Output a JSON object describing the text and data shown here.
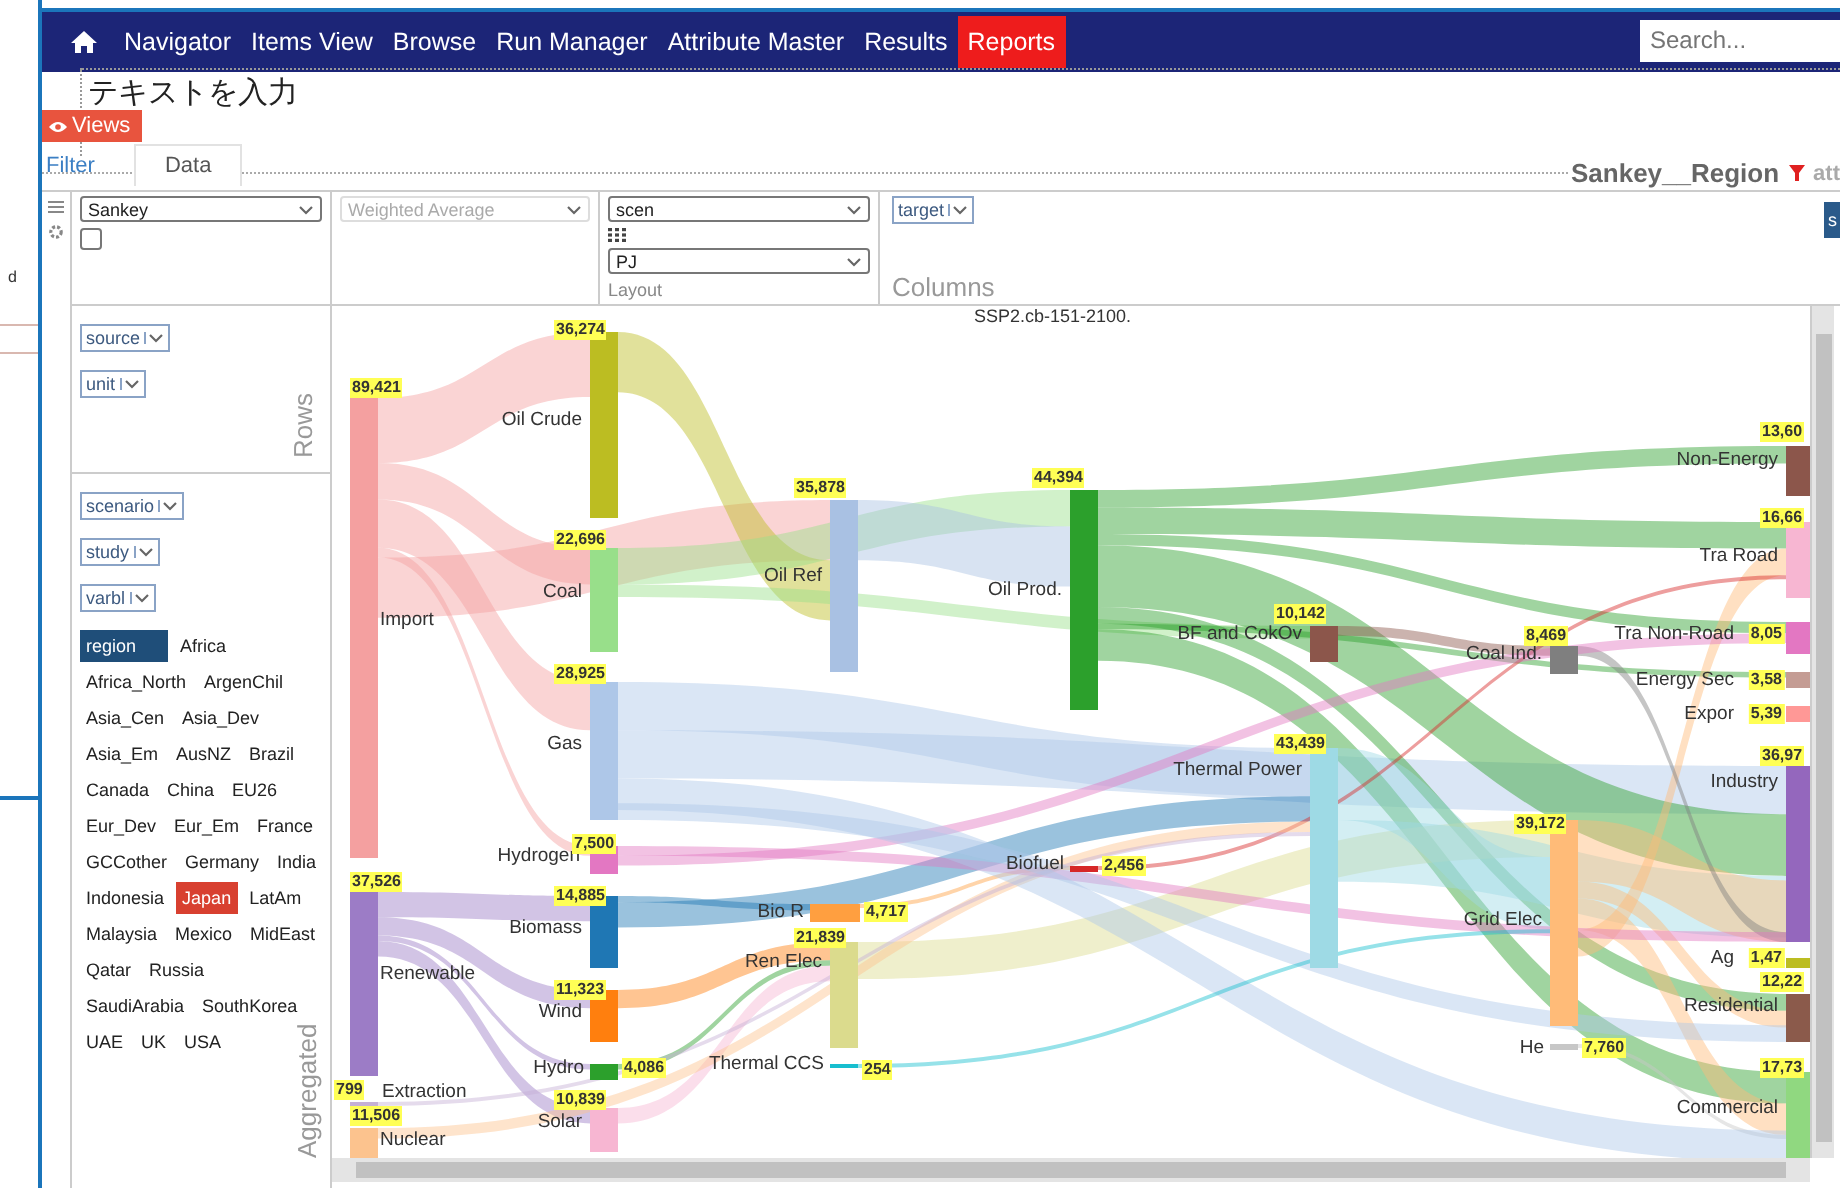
{
  "backdrop_text": "d",
  "nav": {
    "items": [
      {
        "label": "Navigator",
        "selected": false
      },
      {
        "label": "Items View",
        "selected": false
      },
      {
        "label": "Browse",
        "selected": false
      },
      {
        "label": "Run Manager",
        "selected": false
      },
      {
        "label": "Attribute Master",
        "selected": false
      },
      {
        "label": "Results",
        "selected": false
      },
      {
        "label": "Reports",
        "selected": true
      }
    ],
    "search": {
      "placeholder": "Search..."
    }
  },
  "textbox_text": "テキストを入力",
  "views_button": "Views",
  "tabs": [
    {
      "label": "Filter",
      "selected": false
    },
    {
      "label": "Data",
      "selected": true
    }
  ],
  "report_title": "Sankey__Region",
  "attribute_link": "att",
  "pivot": {
    "renderer": "Sankey",
    "checkbox_checked": false,
    "aggregator": "Weighted Average",
    "aggregator_disabled": true,
    "value_field": "scen",
    "unit_field": "PJ",
    "layout_label": "Layout",
    "column_fields": [
      "target"
    ],
    "columns_label": "Columns",
    "side_button": "s",
    "row_fields": [
      "source",
      "unit"
    ],
    "rows_label": "Rows",
    "unused_fields": [
      "scenario",
      "study",
      "varbl"
    ],
    "aggregated_label": "Aggregated",
    "filter": {
      "field": "region",
      "values": [
        {
          "label": "Africa",
          "selected": false
        },
        {
          "label": "Africa_North",
          "selected": false
        },
        {
          "label": "ArgenChil",
          "selected": false
        },
        {
          "label": "Asia_Cen",
          "selected": false
        },
        {
          "label": "Asia_Dev",
          "selected": false
        },
        {
          "label": "Asia_Em",
          "selected": false
        },
        {
          "label": "AusNZ",
          "selected": false
        },
        {
          "label": "Brazil",
          "selected": false
        },
        {
          "label": "Canada",
          "selected": false
        },
        {
          "label": "China",
          "selected": false
        },
        {
          "label": "EU26",
          "selected": false
        },
        {
          "label": "Eur_Dev",
          "selected": false
        },
        {
          "label": "Eur_Em",
          "selected": false
        },
        {
          "label": "France",
          "selected": false
        },
        {
          "label": "GCCother",
          "selected": false
        },
        {
          "label": "Germany",
          "selected": false
        },
        {
          "label": "India",
          "selected": false
        },
        {
          "label": "Indonesia",
          "selected": false
        },
        {
          "label": "Japan",
          "selected": true
        },
        {
          "label": "LatAm",
          "selected": false
        },
        {
          "label": "Malaysia",
          "selected": false
        },
        {
          "label": "Mexico",
          "selected": false
        },
        {
          "label": "MidEast",
          "selected": false
        },
        {
          "label": "Qatar",
          "selected": false
        },
        {
          "label": "Russia",
          "selected": false
        },
        {
          "label": "SaudiArabia",
          "selected": false
        },
        {
          "label": "SouthKorea",
          "selected": false
        },
        {
          "label": "UAE",
          "selected": false
        },
        {
          "label": "UK",
          "selected": false
        },
        {
          "label": "USA",
          "selected": false
        }
      ]
    }
  },
  "sankey": {
    "title": "SSP2.cb-151-2100.",
    "nodes": [
      {
        "label": "Import",
        "value": "89,421",
        "color": "#f4a0a0"
      },
      {
        "label": "Renewable",
        "value": "37,526",
        "color": "#9c7cc6"
      },
      {
        "label": "Extraction",
        "value": "799",
        "color": "#c5b0d5"
      },
      {
        "label": "Nuclear",
        "value": "11,506",
        "color": "#fcc38e"
      },
      {
        "label": "Oil Crude",
        "value": "36,274",
        "color": "#bcbd22"
      },
      {
        "label": "Coal",
        "value": "22,696",
        "color": "#98df8a"
      },
      {
        "label": "Gas",
        "value": "28,925",
        "color": "#aec7e8"
      },
      {
        "label": "Hydrogen",
        "value": "7,500",
        "color": "#e377c2"
      },
      {
        "label": "Biomass",
        "value": "14,885",
        "color": "#1f77b4"
      },
      {
        "label": "Wind",
        "value": "11,323",
        "color": "#ff7f0e"
      },
      {
        "label": "Hydro",
        "value": "4,086",
        "color": "#2ca02c"
      },
      {
        "label": "Solar",
        "value": "10,839",
        "color": "#f7b6d2"
      },
      {
        "label": "Oil Ref",
        "value": "35,878",
        "color": "#a9c1e3"
      },
      {
        "label": "Bio R",
        "value": "4,717",
        "color": "#ff9f40"
      },
      {
        "label": "Ren Elec",
        "value": "21,839",
        "color": "#dbdb8d"
      },
      {
        "label": "Thermal CCS",
        "value": "254",
        "color": "#17becf"
      },
      {
        "label": "Oil Prod.",
        "value": "44,394",
        "color": "#2ca02c"
      },
      {
        "label": "Biofuel",
        "value": "2,456",
        "color": "#d62728"
      },
      {
        "label": "BF and CokOv",
        "value": "10,142",
        "color": "#8c564b"
      },
      {
        "label": "Thermal Power",
        "value": "43,439",
        "color": "#9edae5"
      },
      {
        "label": "Coal Ind.",
        "value": "8,469",
        "color": "#7f7f7f"
      },
      {
        "label": "Grid Elec",
        "value": "39,172",
        "color": "#ffbb78"
      },
      {
        "label": "He",
        "value": "7,760",
        "color": "#c7c7c7"
      },
      {
        "label": "Non-Energy",
        "value": "13,60",
        "color": "#8c564b"
      },
      {
        "label": "Tra Road",
        "value": "16,66",
        "color": "#f7b6d2"
      },
      {
        "label": "Tra Non-Road",
        "value": "8,05",
        "color": "#e377c2"
      },
      {
        "label": "Energy Sec",
        "value": "3,58",
        "color": "#c49c94"
      },
      {
        "label": "Expor",
        "value": "5,39",
        "color": "#ff9896"
      },
      {
        "label": "Industry",
        "value": "36,97",
        "color": "#9467bd"
      },
      {
        "label": "Ag",
        "value": "1,47",
        "color": "#bcbd22"
      },
      {
        "label": "Residential",
        "value": "12,22",
        "color": "#8b5a4b"
      },
      {
        "label": "Commercial",
        "value": "17,73",
        "color": "#90d880"
      }
    ]
  }
}
